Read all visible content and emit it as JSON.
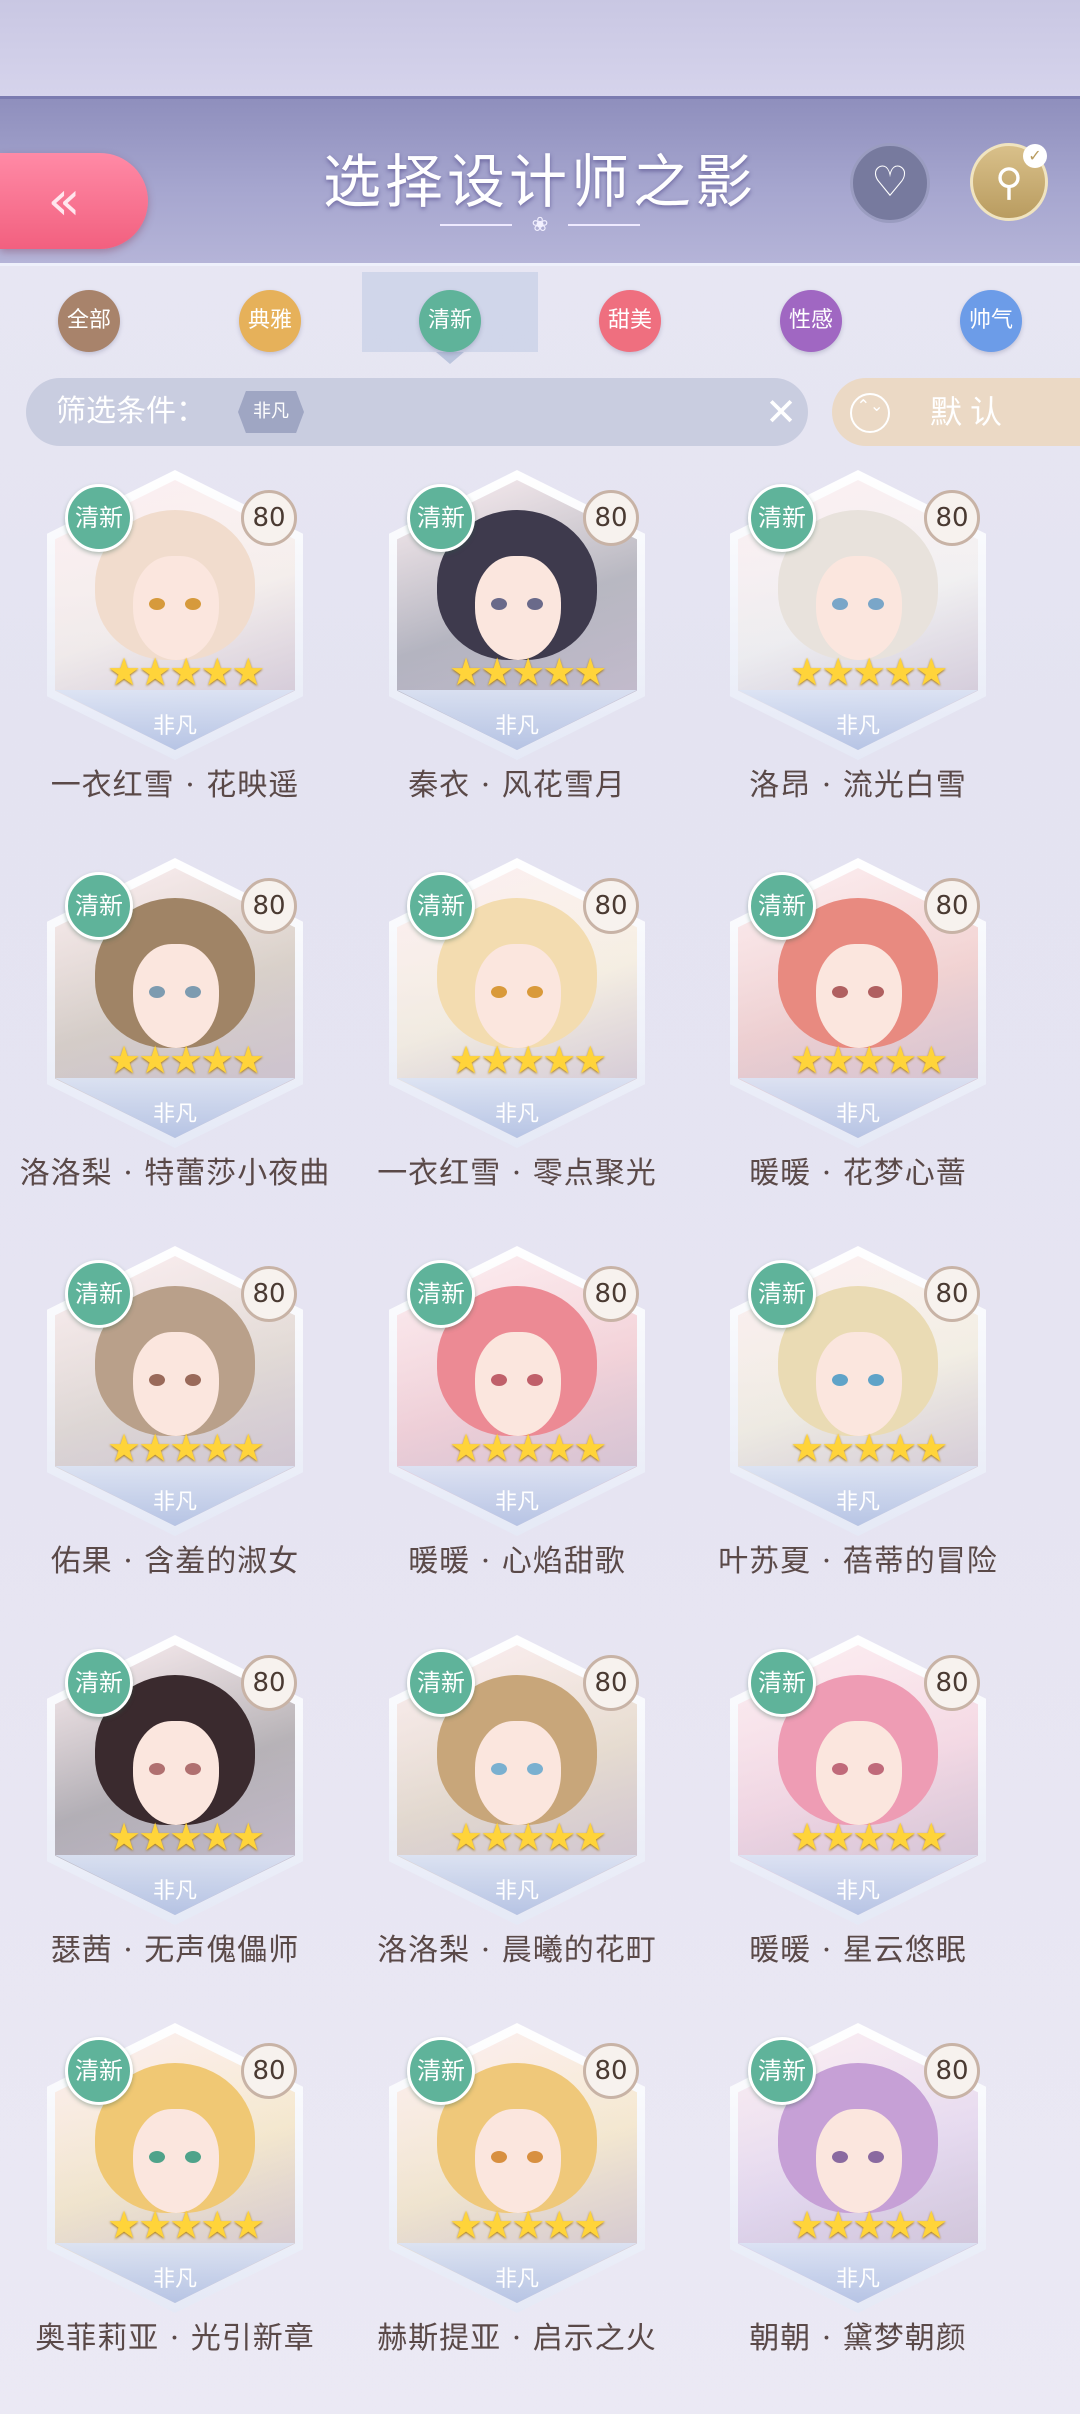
{
  "header": {
    "back_icon": "«",
    "title": "选择设计师之影",
    "ornament": "❀",
    "favorite_icon": "♡",
    "search_icon": "⚲",
    "search_check": "✓"
  },
  "tabs": [
    {
      "label": "全部",
      "color": "#a8836b"
    },
    {
      "label": "典雅",
      "color": "#e6b15a"
    },
    {
      "label": "清新",
      "color": "#5fb39a"
    },
    {
      "label": "甜美",
      "color": "#ef6f7f"
    },
    {
      "label": "性感",
      "color": "#a067c2"
    },
    {
      "label": "帅气",
      "color": "#6c9ce8"
    }
  ],
  "active_tab": "清新",
  "filter": {
    "label": "筛选条件：",
    "chip": "非凡",
    "clear_icon": "✕"
  },
  "sort": {
    "icon": "⌃⌄",
    "label": "默认"
  },
  "cards": [
    {
      "badge": "清新",
      "level": "80",
      "stars": "★★★★★",
      "logo": "非凡",
      "name": "一衣红雪 · 花映遥",
      "hair": "#f1dccd",
      "eye": "#d69a3c"
    },
    {
      "badge": "清新",
      "level": "80",
      "stars": "★★★★★",
      "logo": "非凡",
      "name": "秦衣 · 风花雪月",
      "hair": "#3e3a4d",
      "eye": "#6a6a8a"
    },
    {
      "badge": "清新",
      "level": "80",
      "stars": "★★★★★",
      "logo": "非凡",
      "name": "洛昂 · 流光白雪",
      "hair": "#e8e2dc",
      "eye": "#7aa6c8"
    },
    {
      "badge": "清新",
      "level": "80",
      "stars": "★★★★★",
      "logo": "非凡",
      "name": "洛洛梨 · 特蕾莎小夜曲",
      "hair": "#a08466",
      "eye": "#7d9bb0"
    },
    {
      "badge": "清新",
      "level": "80",
      "stars": "★★★★★",
      "logo": "非凡",
      "name": "一衣红雪 · 零点聚光",
      "hair": "#f3dcb0",
      "eye": "#d99a3a"
    },
    {
      "badge": "清新",
      "level": "80",
      "stars": "★★★★★",
      "logo": "非凡",
      "name": "暖暖 · 花梦心蔷",
      "hair": "#e88a80",
      "eye": "#b06060"
    },
    {
      "badge": "清新",
      "level": "80",
      "stars": "★★★★★",
      "logo": "非凡",
      "name": "佑果 · 含羞的淑女",
      "hair": "#b9a08a",
      "eye": "#9a6a5a"
    },
    {
      "badge": "清新",
      "level": "80",
      "stars": "★★★★★",
      "logo": "非凡",
      "name": "暖暖 · 心焰甜歌",
      "hair": "#ec8a94",
      "eye": "#c0606a"
    },
    {
      "badge": "清新",
      "level": "80",
      "stars": "★★★★★",
      "logo": "非凡",
      "name": "叶苏夏 · 蓓蒂的冒险",
      "hair": "#eadbb4",
      "eye": "#5fa3c8"
    },
    {
      "badge": "清新",
      "level": "80",
      "stars": "★★★★★",
      "logo": "非凡",
      "name": "瑟茜 · 无声傀儡师",
      "hair": "#3a2a2e",
      "eye": "#b07070"
    },
    {
      "badge": "清新",
      "level": "80",
      "stars": "★★★★★",
      "logo": "非凡",
      "name": "洛洛梨 · 晨曦的花町",
      "hair": "#c8a67a",
      "eye": "#7ab0d0"
    },
    {
      "badge": "清新",
      "level": "80",
      "stars": "★★★★★",
      "logo": "非凡",
      "name": "暖暖 · 星云悠眠",
      "hair": "#ee9cb4",
      "eye": "#c06a7a"
    },
    {
      "badge": "清新",
      "level": "80",
      "stars": "★★★★★",
      "logo": "非凡",
      "name": "奥菲莉亚 · 光引新章",
      "hair": "#f0c874",
      "eye": "#4fa38a"
    },
    {
      "badge": "清新",
      "level": "80",
      "stars": "★★★★★",
      "logo": "非凡",
      "name": "赫斯提亚 · 启示之火",
      "hair": "#efc87a",
      "eye": "#d89040"
    },
    {
      "badge": "清新",
      "level": "80",
      "stars": "★★★★★",
      "logo": "非凡",
      "name": "朝朝 · 黛梦朝颜",
      "hair": "#c6a0d6",
      "eye": "#8a6aa0"
    }
  ]
}
